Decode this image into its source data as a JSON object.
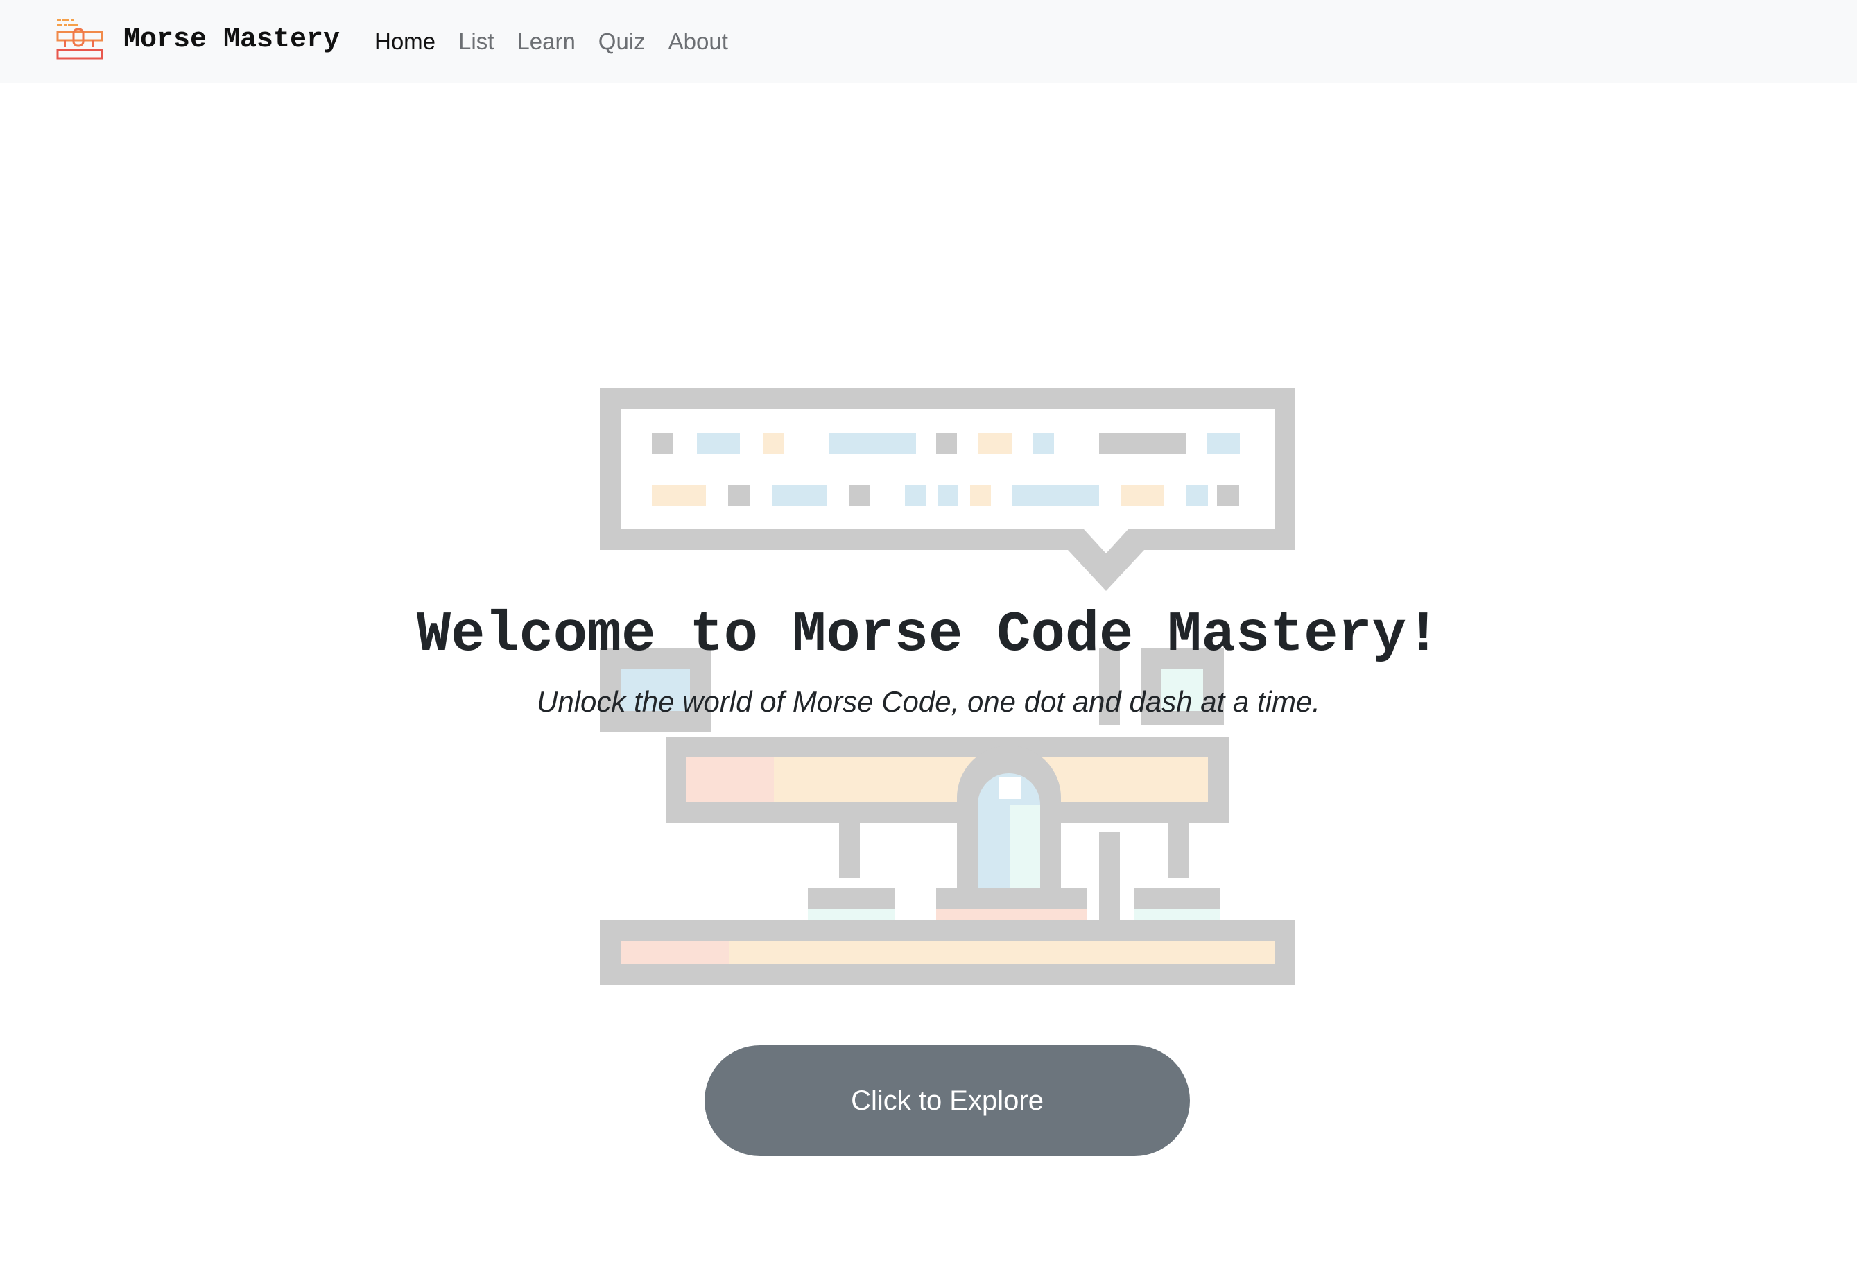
{
  "navbar": {
    "logo_icon": "telegraph-key-icon",
    "brand": "Morse Mastery",
    "links": [
      {
        "label": "Home",
        "active": true
      },
      {
        "label": "List",
        "active": false
      },
      {
        "label": "Learn",
        "active": false
      },
      {
        "label": "Quiz",
        "active": false
      },
      {
        "label": "About",
        "active": false
      }
    ]
  },
  "hero": {
    "illustration_icon": "telegraph-speech-bubble-icon",
    "title": "Welcome to Morse Code Mastery!",
    "subtitle": "Unlock the world of Morse Code, one dot and dash at a time.",
    "button_label": "Click to Explore"
  },
  "colors": {
    "navbar_bg": "#f8f9fa",
    "button_bg": "#6c757d",
    "text_dark": "#212529",
    "nav_muted": "#6c6f73",
    "logo_orange": "#f5a04a",
    "logo_red": "#e8584d"
  }
}
